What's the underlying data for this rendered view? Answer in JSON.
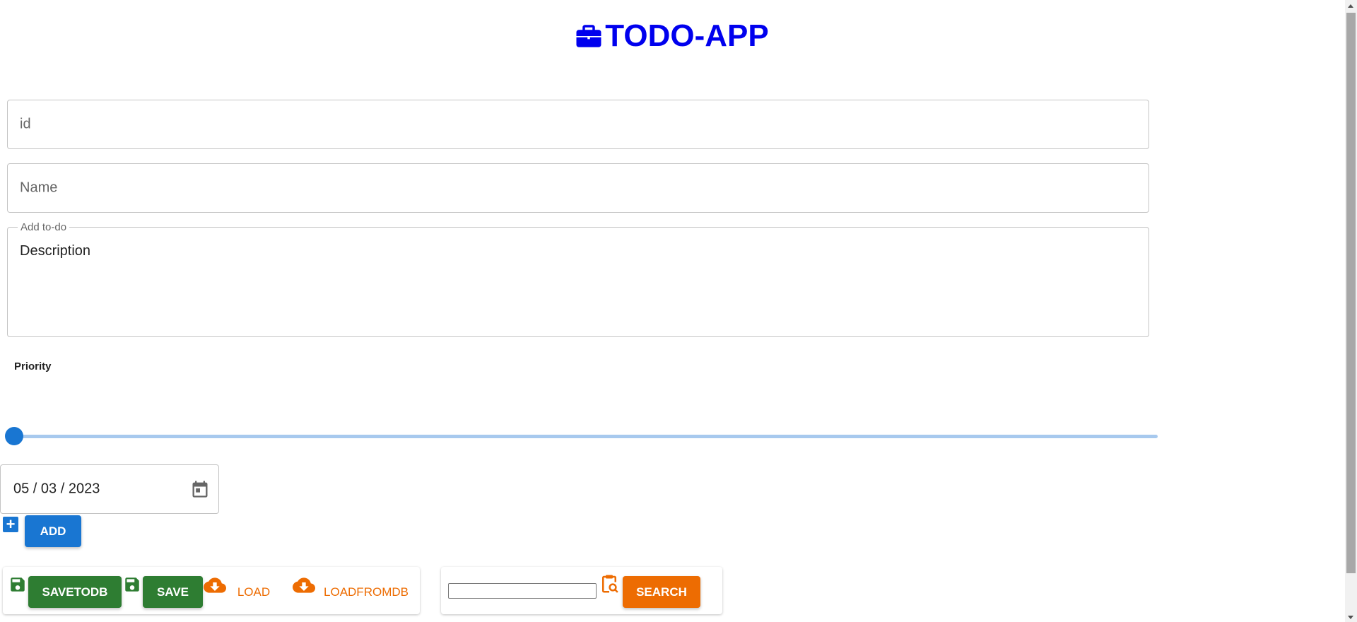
{
  "app": {
    "title": "TODO-APP",
    "brand_color": "#0000ee"
  },
  "form": {
    "id_placeholder": "id",
    "name_placeholder": "Name",
    "description_legend": "Add to-do",
    "description_placeholder": "Description",
    "priority_label": "Priority",
    "priority_value": 0,
    "date_value": "05 / 03 / 2023",
    "add_button": "ADD"
  },
  "actions": {
    "savetodb_button": "SAVETODB",
    "save_button": "SAVE",
    "load_button": "LOAD",
    "loadfromdb_button": "LOADFROMDB"
  },
  "search": {
    "input_value": "",
    "button": "SEARCH"
  },
  "colors": {
    "primary": "#1976d2",
    "success": "#2e7d32",
    "warning": "#ed6c02"
  },
  "icons": {
    "logo": "briefcase-icon",
    "date": "calendar-icon",
    "add": "plus-box-icon",
    "save": "floppy-disk-icon",
    "load": "cloud-download-icon",
    "search": "clipboard-search-icon"
  }
}
